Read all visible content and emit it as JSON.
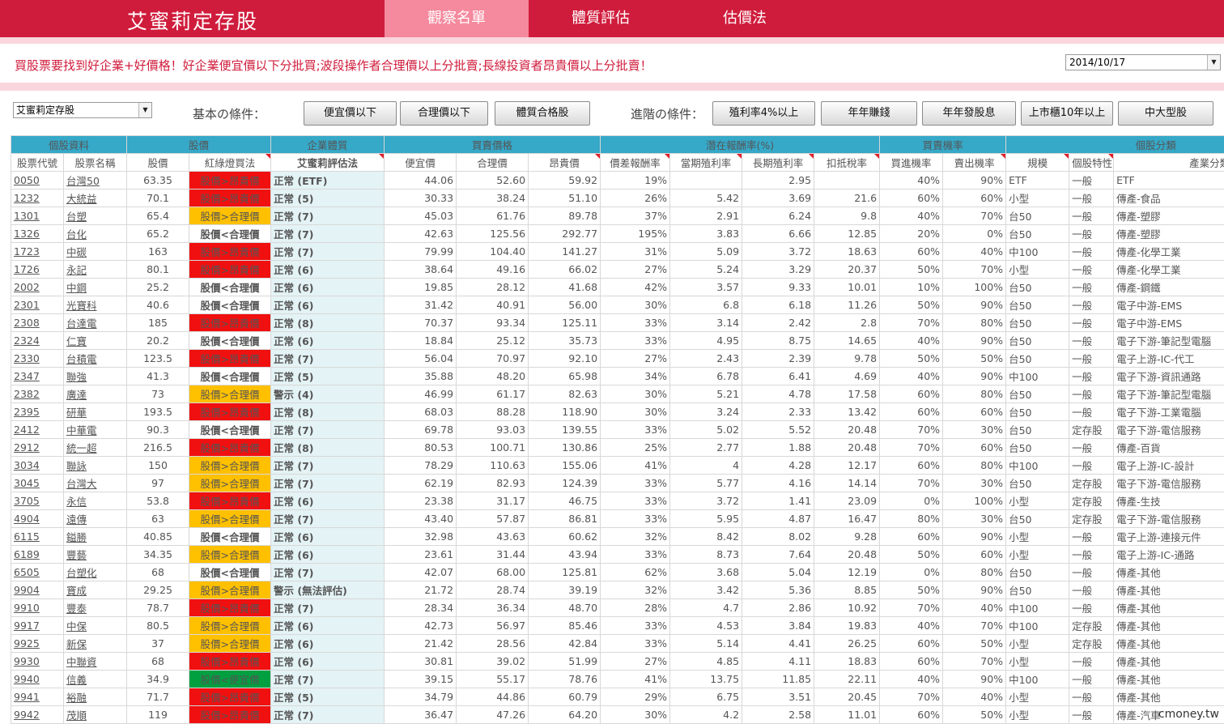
{
  "app": {
    "brand": "艾蜜莉定存股",
    "tabs": [
      "觀察名單",
      "體質評估",
      "估價法"
    ]
  },
  "header": {
    "slogan": "買股票要找到好企業+好價格！好企業便宜價以下分批買;波段操作者合理價以上分批賣;長線投資者昂貴價以上分批賣！",
    "date": "2014/10/17"
  },
  "filters": {
    "list_select": "艾蜜莉定存股",
    "basic_label": "基本の條件：",
    "basic_buttons": [
      "便宜價以下",
      "合理價以下",
      "體質合格股"
    ],
    "advanced_label": "進階の條件：",
    "advanced_buttons": [
      "殖利率4%以上",
      "年年賺錢",
      "年年發股息",
      "上市櫃10年以上",
      "中大型股"
    ]
  },
  "table": {
    "group_headers": [
      "個股資料",
      "股價",
      "企業體質",
      "買賣價格",
      "潛在報酬率(%)",
      "買賣機率",
      "個股分類"
    ],
    "columns": [
      "股票代號",
      "股票名稱",
      "股價",
      "紅綠燈買法",
      "艾蜜莉評估法",
      "便宜價",
      "合理價",
      "昂貴價",
      "價差報酬率",
      "當期殖利率",
      "長期殖利率",
      "扣抵稅率",
      "買進機率",
      "賣出機率",
      "規模",
      "個股特性",
      "產業分類"
    ],
    "rows": [
      [
        "0050",
        "台灣50",
        "63.35",
        "股價>昂貴價",
        "正常 (ETF)",
        "44.06",
        "52.60",
        "59.92",
        "19%",
        "",
        "2.95",
        "",
        "40%",
        "90%",
        "ETF",
        "一般",
        "ETF"
      ],
      [
        "1232",
        "大統益",
        "70.1",
        "股價>昂貴價",
        "正常 (5)",
        "30.33",
        "38.24",
        "51.10",
        "26%",
        "5.42",
        "3.69",
        "21.6",
        "60%",
        "60%",
        "小型",
        "一般",
        "傳產-食品"
      ],
      [
        "1301",
        "台塑",
        "65.4",
        "股價>合理價",
        "正常 (7)",
        "45.03",
        "61.76",
        "89.78",
        "37%",
        "2.91",
        "6.24",
        "9.8",
        "40%",
        "70%",
        "台50",
        "一般",
        "傳產-塑膠"
      ],
      [
        "1326",
        "台化",
        "65.2",
        "股價<合理價",
        "正常 (7)",
        "42.63",
        "125.56",
        "292.77",
        "195%",
        "3.83",
        "6.66",
        "12.85",
        "20%",
        "0%",
        "台50",
        "一般",
        "傳產-塑膠"
      ],
      [
        "1723",
        "中碳",
        "163",
        "股價>昂貴價",
        "正常 (7)",
        "79.99",
        "104.40",
        "141.27",
        "31%",
        "5.09",
        "3.72",
        "18.63",
        "60%",
        "40%",
        "中100",
        "一般",
        "傳產-化學工業"
      ],
      [
        "1726",
        "永記",
        "80.1",
        "股價>昂貴價",
        "正常 (6)",
        "38.64",
        "49.16",
        "66.02",
        "27%",
        "5.24",
        "3.29",
        "20.37",
        "50%",
        "70%",
        "小型",
        "一般",
        "傳產-化學工業"
      ],
      [
        "2002",
        "中鋼",
        "25.2",
        "股價<合理價",
        "正常 (6)",
        "19.85",
        "28.12",
        "41.68",
        "42%",
        "3.57",
        "9.33",
        "10.01",
        "10%",
        "100%",
        "台50",
        "一般",
        "傳產-鋼鐵"
      ],
      [
        "2301",
        "光寶科",
        "40.6",
        "股價<合理價",
        "正常 (6)",
        "31.42",
        "40.91",
        "56.00",
        "30%",
        "6.8",
        "6.18",
        "11.26",
        "50%",
        "90%",
        "台50",
        "一般",
        "電子中游-EMS"
      ],
      [
        "2308",
        "台達電",
        "185",
        "股價>昂貴價",
        "正常 (8)",
        "70.37",
        "93.34",
        "125.11",
        "33%",
        "3.14",
        "2.42",
        "2.8",
        "70%",
        "80%",
        "台50",
        "一般",
        "電子中游-EMS"
      ],
      [
        "2324",
        "仁寶",
        "20.2",
        "股價<合理價",
        "正常 (6)",
        "18.84",
        "25.12",
        "35.73",
        "33%",
        "4.95",
        "8.75",
        "14.65",
        "40%",
        "90%",
        "台50",
        "一般",
        "電子下游-筆記型電腦"
      ],
      [
        "2330",
        "台積電",
        "123.5",
        "股價>昂貴價",
        "正常 (7)",
        "56.04",
        "70.97",
        "92.10",
        "27%",
        "2.43",
        "2.39",
        "9.78",
        "50%",
        "50%",
        "台50",
        "一般",
        "電子上游-IC-代工"
      ],
      [
        "2347",
        "聯強",
        "41.3",
        "股價<合理價",
        "正常 (5)",
        "35.88",
        "48.20",
        "65.98",
        "34%",
        "6.78",
        "6.41",
        "4.69",
        "40%",
        "90%",
        "中100",
        "一般",
        "電子下游-資訊通路"
      ],
      [
        "2382",
        "廣達",
        "73",
        "股價>合理價",
        "警示 (4)",
        "46.99",
        "61.17",
        "82.63",
        "30%",
        "5.21",
        "4.78",
        "17.58",
        "60%",
        "80%",
        "台50",
        "一般",
        "電子下游-筆記型電腦"
      ],
      [
        "2395",
        "研華",
        "193.5",
        "股價>昂貴價",
        "正常 (8)",
        "68.03",
        "88.28",
        "118.90",
        "30%",
        "3.24",
        "2.33",
        "13.42",
        "60%",
        "60%",
        "台50",
        "一般",
        "電子下游-工業電腦"
      ],
      [
        "2412",
        "中華電",
        "90.3",
        "股價<合理價",
        "正常 (7)",
        "69.78",
        "93.03",
        "139.55",
        "33%",
        "5.02",
        "5.52",
        "20.48",
        "70%",
        "30%",
        "台50",
        "定存股",
        "電子下游-電信服務"
      ],
      [
        "2912",
        "統一超",
        "216.5",
        "股價>昂貴價",
        "正常 (8)",
        "80.53",
        "100.71",
        "130.86",
        "25%",
        "2.77",
        "1.88",
        "20.48",
        "70%",
        "60%",
        "台50",
        "一般",
        "傳產-百貨"
      ],
      [
        "3034",
        "聯詠",
        "150",
        "股價>合理價",
        "正常 (7)",
        "78.29",
        "110.63",
        "155.06",
        "41%",
        "4",
        "4.28",
        "12.17",
        "60%",
        "80%",
        "中100",
        "一般",
        "電子上游-IC-設計"
      ],
      [
        "3045",
        "台灣大",
        "97",
        "股價>合理價",
        "正常 (7)",
        "62.19",
        "82.93",
        "124.39",
        "33%",
        "5.77",
        "4.16",
        "14.14",
        "70%",
        "30%",
        "台50",
        "定存股",
        "電子下游-電信服務"
      ],
      [
        "3705",
        "永信",
        "53.8",
        "股價>昂貴價",
        "正常 (6)",
        "23.38",
        "31.17",
        "46.75",
        "33%",
        "3.72",
        "1.41",
        "23.09",
        "0%",
        "100%",
        "小型",
        "定存股",
        "傳產-生技"
      ],
      [
        "4904",
        "遠傳",
        "63",
        "股價>合理價",
        "正常 (7)",
        "43.40",
        "57.87",
        "86.81",
        "33%",
        "5.95",
        "4.87",
        "16.47",
        "80%",
        "30%",
        "台50",
        "定存股",
        "電子下游-電信服務"
      ],
      [
        "6115",
        "鎰勝",
        "40.85",
        "股價<合理價",
        "正常 (6)",
        "32.98",
        "43.63",
        "60.62",
        "32%",
        "8.42",
        "8.02",
        "9.28",
        "60%",
        "90%",
        "小型",
        "一般",
        "電子上游-連接元件"
      ],
      [
        "6189",
        "豐藝",
        "34.35",
        "股價>合理價",
        "正常 (6)",
        "23.61",
        "31.44",
        "43.94",
        "33%",
        "8.73",
        "7.64",
        "20.48",
        "50%",
        "60%",
        "小型",
        "一般",
        "電子上游-IC-通路"
      ],
      [
        "6505",
        "台塑化",
        "68",
        "股價<合理價",
        "正常 (7)",
        "42.07",
        "68.00",
        "125.81",
        "62%",
        "3.68",
        "5.04",
        "12.19",
        "0%",
        "80%",
        "台50",
        "一般",
        "傳產-其他"
      ],
      [
        "9904",
        "寶成",
        "29.25",
        "股價>合理價",
        "警示 (無法評估)",
        "21.72",
        "28.74",
        "39.19",
        "32%",
        "3.42",
        "5.36",
        "8.85",
        "50%",
        "90%",
        "台50",
        "一般",
        "傳產-其他"
      ],
      [
        "9910",
        "豐泰",
        "78.7",
        "股價>昂貴價",
        "正常 (7)",
        "28.34",
        "36.34",
        "48.70",
        "28%",
        "4.7",
        "2.86",
        "10.92",
        "70%",
        "40%",
        "中100",
        "一般",
        "傳產-其他"
      ],
      [
        "9917",
        "中保",
        "80.5",
        "股價>合理價",
        "正常 (6)",
        "42.73",
        "56.97",
        "85.46",
        "33%",
        "4.53",
        "3.84",
        "19.83",
        "40%",
        "70%",
        "中100",
        "定存股",
        "傳產-其他"
      ],
      [
        "9925",
        "新保",
        "37",
        "股價>合理價",
        "正常 (6)",
        "21.42",
        "28.56",
        "42.84",
        "33%",
        "5.14",
        "4.41",
        "26.25",
        "60%",
        "50%",
        "小型",
        "定存股",
        "傳產-其他"
      ],
      [
        "9930",
        "中聯資",
        "68",
        "股價>昂貴價",
        "正常 (6)",
        "30.81",
        "39.02",
        "51.99",
        "27%",
        "4.85",
        "4.11",
        "18.83",
        "60%",
        "70%",
        "小型",
        "一般",
        "傳產-其他"
      ],
      [
        "9940",
        "信義",
        "34.9",
        "股價<便宜價",
        "正常 (7)",
        "39.15",
        "55.17",
        "78.76",
        "41%",
        "13.75",
        "11.85",
        "22.11",
        "40%",
        "90%",
        "中100",
        "一般",
        "傳產-其他"
      ],
      [
        "9941",
        "裕融",
        "71.7",
        "股價>昂貴價",
        "正常 (5)",
        "34.79",
        "44.86",
        "60.79",
        "29%",
        "6.75",
        "3.51",
        "20.45",
        "70%",
        "40%",
        "小型",
        "一般",
        "傳產-其他"
      ],
      [
        "9942",
        "茂順",
        "119",
        "股價>昂貴價",
        "正常 (7)",
        "36.47",
        "47.26",
        "64.20",
        "30%",
        "4.2",
        "2.58",
        "11.01",
        "60%",
        "50%",
        "小型",
        "一般",
        "傳產-汽車"
      ]
    ],
    "signal_colors": {
      "股價>昂貴價": "red",
      "股價>合理價": "yellow",
      "股價<合理價": "none",
      "股價<便宜價": "green"
    }
  },
  "watermark": "cmoney.tw"
}
